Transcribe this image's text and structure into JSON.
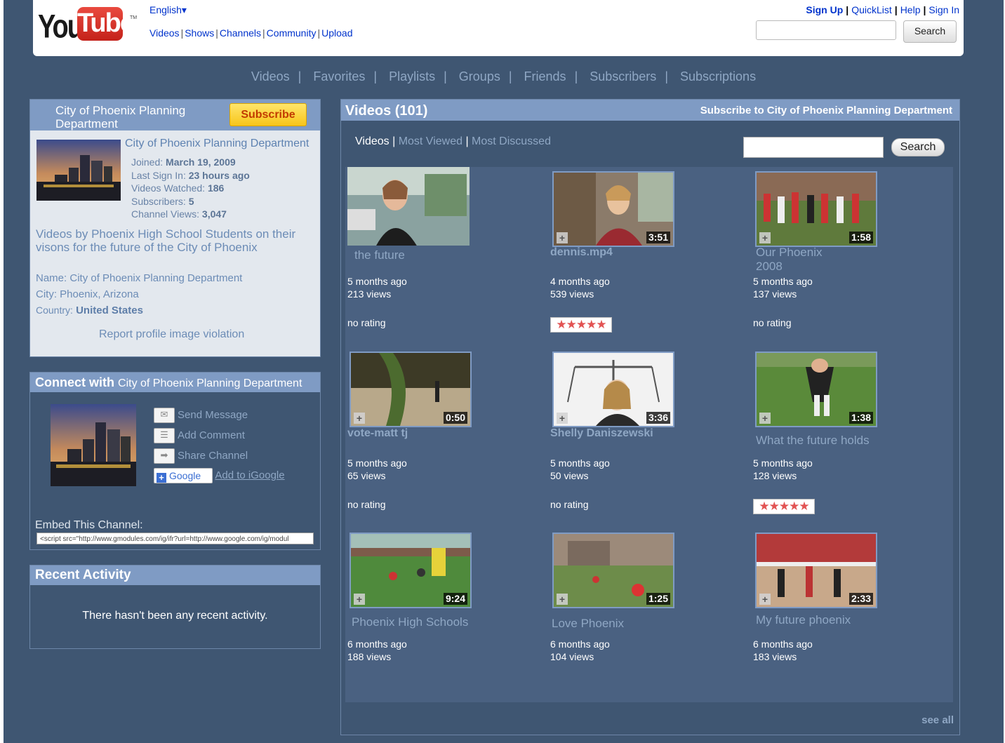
{
  "header": {
    "logo": {
      "you": "You",
      "tube": "Tube",
      "tm": "TM"
    },
    "language": "English",
    "nav": [
      "Videos",
      "Shows",
      "Channels",
      "Community",
      "Upload"
    ],
    "account": {
      "signup": "Sign Up",
      "quicklist": "QuickList",
      "help": "Help",
      "signin": "Sign In"
    },
    "search_button": "Search"
  },
  "channel_nav": [
    "Videos",
    "Favorites",
    "Playlists",
    "Groups",
    "Friends",
    "Subscribers",
    "Subscriptions"
  ],
  "profile": {
    "title": "City of Phoenix Planning Department",
    "subscribe_label": "Subscribe",
    "name": "City of Phoenix Planning Department",
    "joined_label": "Joined:",
    "joined": "March 19, 2009",
    "last_signin_label": "Last Sign In:",
    "last_signin": "23 hours ago",
    "videos_watched_label": "Videos Watched:",
    "videos_watched": "186",
    "subscribers_label": "Subscribers:",
    "subscribers": "5",
    "channel_views_label": "Channel Views:",
    "channel_views": "3,047",
    "description": "Videos by Phoenix High School Students on their visons for the future of the City of Phoenix",
    "info_name_label": "Name:",
    "info_name": "City of Phoenix Planning Department",
    "info_city_label": "City:",
    "info_city": "Phoenix, Arizona",
    "info_country_label": "Country:",
    "info_country": "United States",
    "report": "Report profile image violation"
  },
  "connect": {
    "title_bold": "Connect with",
    "title_name": "City of Phoenix Planning Department",
    "actions": {
      "send_message": "Send Message",
      "add_comment": "Add Comment",
      "share_channel": "Share Channel",
      "igoogle_badge": "Google",
      "add_igoogle": "Add to iGoogle"
    },
    "embed_label": "Embed This Channel:",
    "embed_code": "<script src=\"http://www.gmodules.com/ig/ifr?url=http://www.google.com/ig/modul"
  },
  "recent": {
    "title": "Recent Activity",
    "text": "There hasn't been any recent activity."
  },
  "videos_panel": {
    "title": "Videos (101)",
    "subscribe_link": "Subscribe to City of Phoenix Planning Department",
    "tabs": {
      "videos": "Videos",
      "most_viewed": "Most Viewed",
      "most_discussed": "Most Discussed"
    },
    "search_button": "Search",
    "see_all": "see all",
    "items": [
      {
        "title": "the future",
        "duration": "",
        "age": "5 months ago",
        "views": "213 views",
        "rating": "no rating",
        "stars": 0
      },
      {
        "title": "dennis.mp4",
        "duration": "3:51",
        "age": "4 months ago",
        "views": "539 views",
        "rating": "",
        "stars": 5
      },
      {
        "title": "Our Phoenix 2008",
        "duration": "1:58",
        "age": "5 months ago",
        "views": "137 views",
        "rating": "no rating",
        "stars": 0
      },
      {
        "title": "vote-matt tj",
        "duration": "0:50",
        "age": "5 months ago",
        "views": "65 views",
        "rating": "no rating",
        "stars": 0
      },
      {
        "title": "Shelly Daniszewski",
        "duration": "3:36",
        "age": "5 months ago",
        "views": "50 views",
        "rating": "no rating",
        "stars": 0
      },
      {
        "title": "What the future holds",
        "duration": "1:38",
        "age": "5 months ago",
        "views": "128 views",
        "rating": "",
        "stars": 5
      },
      {
        "title": "Phoenix High Schools",
        "duration": "9:24",
        "age": "6 months ago",
        "views": "188 views",
        "rating": "",
        "stars": 0
      },
      {
        "title": "Love Phoenix",
        "duration": "1:25",
        "age": "6 months ago",
        "views": "104 views",
        "rating": "",
        "stars": 0
      },
      {
        "title": "My future phoenix",
        "duration": "2:33",
        "age": "6 months ago",
        "views": "183 views",
        "rating": "",
        "stars": 0
      }
    ]
  },
  "colors": {
    "background": "#3f5672",
    "panel_header": "#7f9bc4",
    "link_blue": "#0033cc",
    "muted_link": "#8fa7c4",
    "subscribe_yellow": "#f7c51a"
  }
}
